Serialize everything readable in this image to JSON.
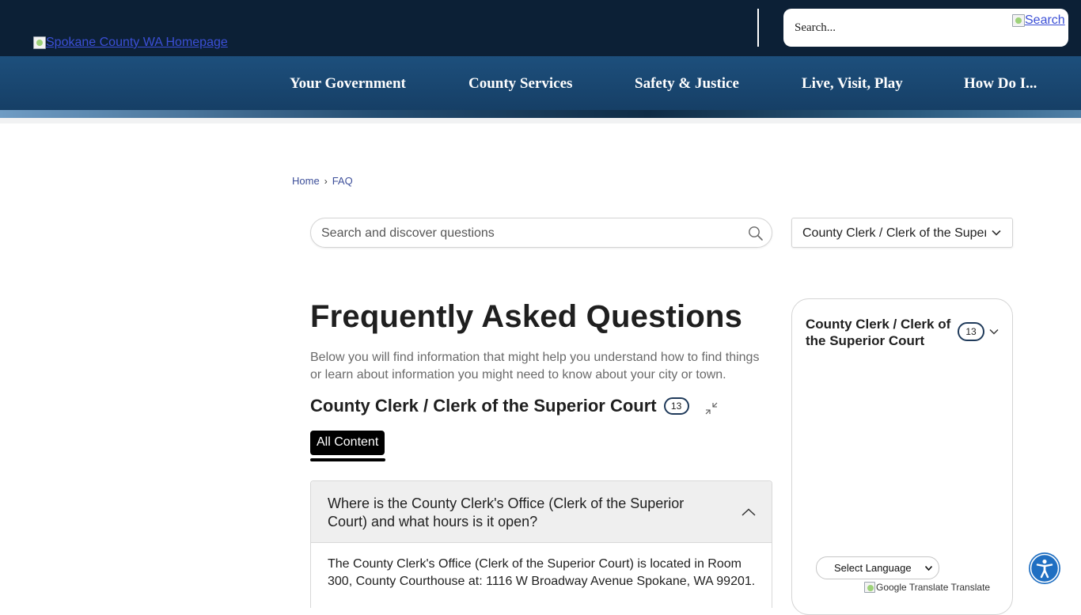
{
  "header": {
    "logo_alt": "Spokane County WA Homepage",
    "search_placeholder": "Search...",
    "search_button": "Search"
  },
  "nav": {
    "items": [
      {
        "label": "Your Government"
      },
      {
        "label": "County Services"
      },
      {
        "label": "Safety & Justice"
      },
      {
        "label": "Live, Visit, Play"
      },
      {
        "label": "How Do I..."
      }
    ]
  },
  "breadcrumb": {
    "home": "Home",
    "separator": "›",
    "current": "FAQ"
  },
  "faq_search": {
    "placeholder": "Search and discover questions"
  },
  "category_select": {
    "selected": "County Clerk / Clerk of the Superior Court"
  },
  "main": {
    "title": "Frequently Asked Questions",
    "intro": "Below you will find information that might help you understand how to find things or learn about information you might need to know about your city or town.",
    "category_title": "County Clerk / Clerk of the Superior Court",
    "category_count": "13",
    "tab_label": "All Content"
  },
  "faq": {
    "items": [
      {
        "question": "Where is the County Clerk's Office (Clerk of the Superior Court) and what hours is it open?",
        "answer": "The County Clerk's Office (Clerk of the Superior Court) is located in Room 300, County Courthouse at: 1116 W Broadway Avenue Spokane, WA 99201."
      }
    ]
  },
  "sidebar": {
    "category_title": "County Clerk / Clerk of the Superior Court",
    "category_count": "13"
  },
  "translate": {
    "select_label": "Select Language",
    "powered_by": "Google Translate Translate"
  },
  "colors": {
    "header_bg": "#0c2036",
    "nav_bg": "#1d4f7c",
    "accent_blue": "#1f6fc2",
    "link": "#3d4f9a"
  }
}
